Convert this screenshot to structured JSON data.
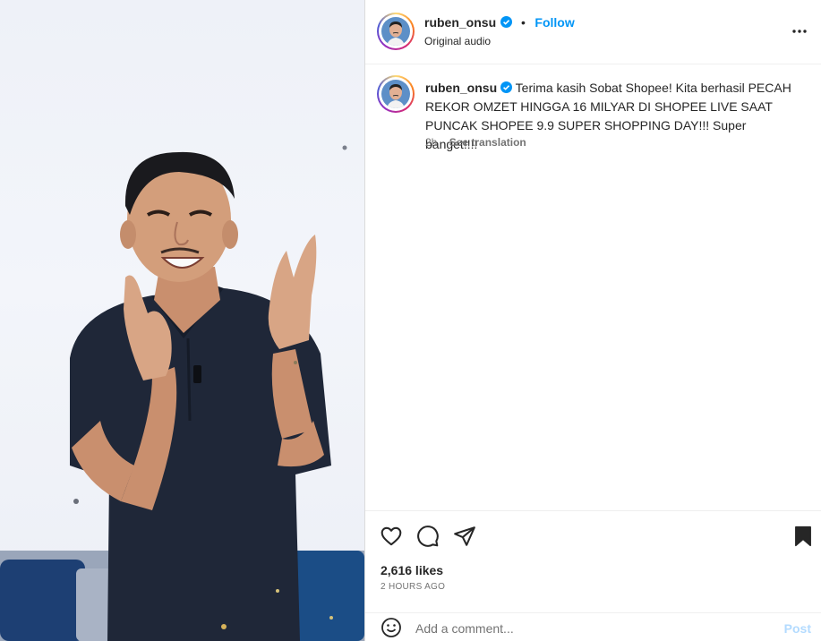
{
  "author": {
    "username": "ruben_onsu",
    "verified": true,
    "follow_label": "Follow",
    "separator": "•",
    "audio_label": "Original audio"
  },
  "caption": {
    "username": "ruben_onsu",
    "text": "Terima kasih Sobat Shopee! Kita berhasil PECAH REKOR OMZET HINGGA 16 MILYAR DI SHOPEE LIVE SAAT PUNCAK SHOPEE 9.9 SUPER SHOPPING DAY!!! Super banget!!!!",
    "age": "2h",
    "see_translation": "See translation"
  },
  "actions": {
    "like_icon": "heart-outline-icon",
    "comment_icon": "comment-bubble-icon",
    "share_icon": "paper-plane-icon",
    "save_icon": "bookmark-filled-icon"
  },
  "stats": {
    "likes": "2,616 likes",
    "posted": "2 HOURS AGO"
  },
  "comment": {
    "emoji_icon": "smiley-icon",
    "placeholder": "Add a comment...",
    "post_label": "Post"
  },
  "colors": {
    "accent": "#0095f6",
    "verified": "#0095f6",
    "post_disabled": "#b3dbff",
    "shirt": "#1f2738"
  }
}
